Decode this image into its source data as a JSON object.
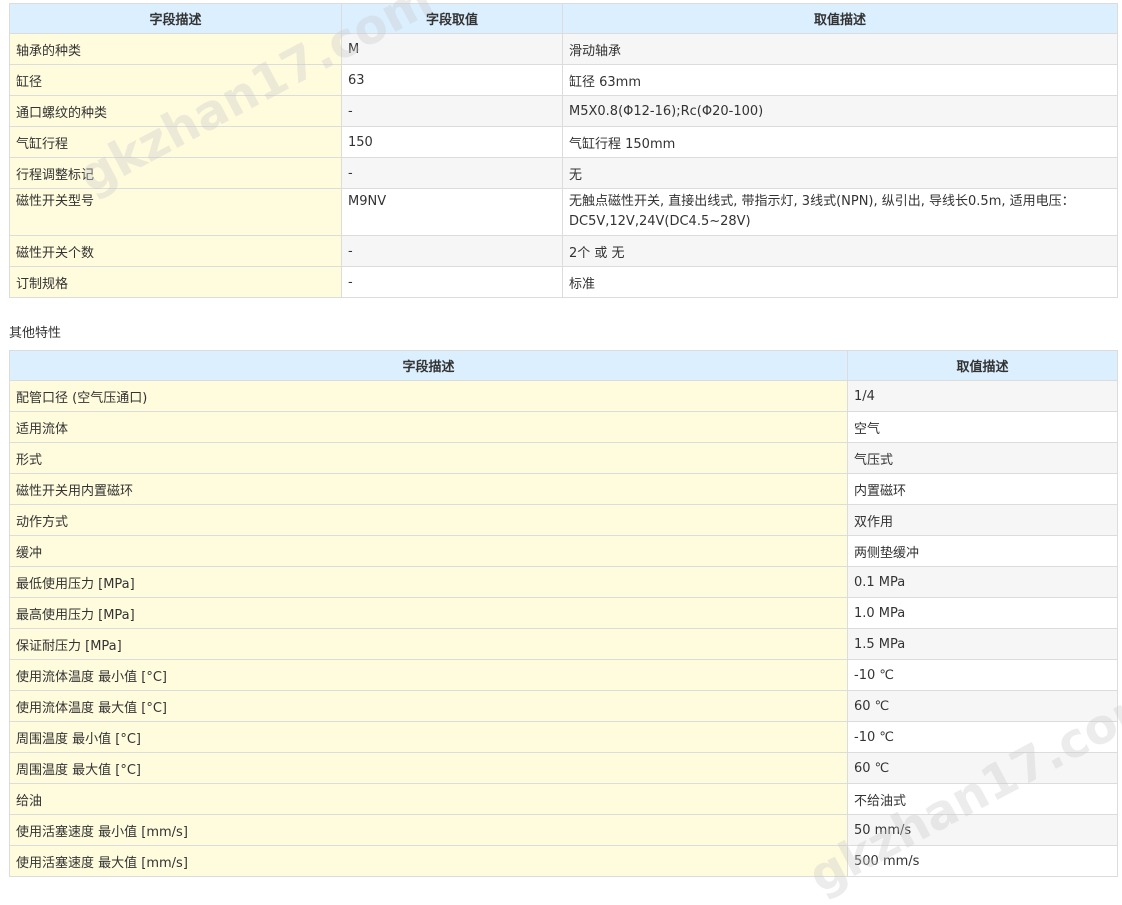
{
  "table1": {
    "headers": [
      "字段描述",
      "字段取值",
      "取值描述"
    ],
    "rows": [
      {
        "name": "轴承的种类",
        "value": "M",
        "desc": "滑动轴承"
      },
      {
        "name": "缸径",
        "value": "63",
        "desc": "缸径 63mm"
      },
      {
        "name": "通口螺纹的种类",
        "value": "-",
        "desc": "M5X0.8(Φ12-16);Rc(Φ20-100)"
      },
      {
        "name": "气缸行程",
        "value": "150",
        "desc": "气缸行程 150mm"
      },
      {
        "name": "行程调整标记",
        "value": "-",
        "desc": "无"
      },
      {
        "name": "磁性开关型号",
        "value": "M9NV",
        "desc": "无触点磁性开关, 直接出线式, 带指示灯, 3线式(NPN), 纵引出, 导线长0.5m, 适用电压：DC5V,12V,24V(DC4.5~28V)"
      },
      {
        "name": "磁性开关个数",
        "value": "-",
        "desc": "2个 或 无"
      },
      {
        "name": "订制规格",
        "value": "-",
        "desc": "标准"
      }
    ]
  },
  "section_title": "其他特性",
  "table2": {
    "headers": [
      "字段描述",
      "取值描述"
    ],
    "rows": [
      {
        "name": "配管口径 (空气压通口)",
        "desc": "1/4"
      },
      {
        "name": "适用流体",
        "desc": "空气"
      },
      {
        "name": "形式",
        "desc": "气压式"
      },
      {
        "name": "磁性开关用内置磁环",
        "desc": "内置磁环"
      },
      {
        "name": "动作方式",
        "desc": "双作用"
      },
      {
        "name": "缓冲",
        "desc": "两侧垫缓冲"
      },
      {
        "name": "最低使用压力 [MPa]",
        "desc": "0.1 MPa"
      },
      {
        "name": "最高使用压力 [MPa]",
        "desc": "1.0 MPa"
      },
      {
        "name": "保证耐压力 [MPa]",
        "desc": "1.5 MPa"
      },
      {
        "name": "使用流体温度 最小值 [°C]",
        "desc": "-10 ℃"
      },
      {
        "name": "使用流体温度 最大值 [°C]",
        "desc": "60 ℃"
      },
      {
        "name": "周围温度 最小值 [°C]",
        "desc": "-10 ℃"
      },
      {
        "name": "周围温度 最大值 [°C]",
        "desc": "60 ℃"
      },
      {
        "name": "给油",
        "desc": "不给油式"
      },
      {
        "name": "使用活塞速度 最小值 [mm/s]",
        "desc": "50 mm/s"
      },
      {
        "name": "使用活塞速度 最大值 [mm/s]",
        "desc": "500 mm/s"
      }
    ]
  },
  "watermark": "gkzhan17.com"
}
